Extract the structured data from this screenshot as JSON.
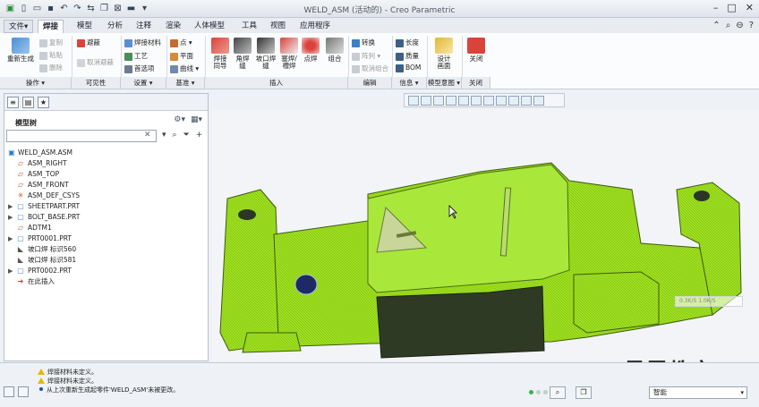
{
  "app": {
    "title": "WELD_ASM (活动的) - Creo Parametric"
  },
  "tabs": [
    "文件",
    "焊接",
    "模型",
    "分析",
    "注释",
    "渲染",
    "人体模型",
    "工具",
    "视图",
    "应用程序"
  ],
  "ribbon": {
    "operations": {
      "regenerate": "重新生成",
      "copy": "复制",
      "paste": "粘贴",
      "delete": "删除",
      "group": "操作"
    },
    "visibility": {
      "avoid": "避蔽",
      "cancel_avoid": "取消避蔽",
      "group": "可见性"
    },
    "settings": {
      "weld_material": "焊接材料",
      "process": "工艺",
      "preferences": "首选项",
      "group": "设置"
    },
    "datum": {
      "point": "点",
      "plane": "平面",
      "curve": "曲线",
      "group": "基准"
    },
    "insert": {
      "weld_to": "焊接\n同导",
      "fillet": "角焊\n缝",
      "groove": "坡口焊\n缝",
      "plug_slot": "塞焊/\n槽焊",
      "spot": "点焊",
      "combine": "组合",
      "group": "插入"
    },
    "edit": {
      "convert": "转换",
      "pattern": "阵列",
      "ungroup": "取消组合",
      "group": "编辑"
    },
    "info": {
      "length": "长度",
      "mass": "质量",
      "bom": "BOM",
      "group": "信息"
    },
    "model_intent": {
      "notebook": "设计\n画面",
      "group": "模型意图"
    },
    "close": {
      "label": "关闭",
      "group": "关闭"
    }
  },
  "left_panel": {
    "title": "模型树",
    "search_placeholder": "",
    "tree": [
      {
        "label": "WELD_ASM.ASM",
        "icon": "assembly-icon",
        "expand": "",
        "root": true
      },
      {
        "label": "ASM_RIGHT",
        "icon": "datum-plane-icon",
        "expand": ""
      },
      {
        "label": "ASM_TOP",
        "icon": "datum-plane-icon",
        "expand": ""
      },
      {
        "label": "ASM_FRONT",
        "icon": "datum-plane-icon",
        "expand": ""
      },
      {
        "label": "ASM_DEF_CSYS",
        "icon": "csys-icon",
        "expand": ""
      },
      {
        "label": "SHEETPART.PRT",
        "icon": "part-icon",
        "expand": "▶"
      },
      {
        "label": "BOLT_BASE.PRT",
        "icon": "part-icon",
        "expand": "▶"
      },
      {
        "label": "ADTM1",
        "icon": "datum-plane-icon",
        "expand": ""
      },
      {
        "label": "PRT0001.PRT",
        "icon": "part-icon",
        "expand": "▶"
      },
      {
        "label": "坡口焊 标识560",
        "icon": "weld-icon",
        "expand": ""
      },
      {
        "label": "坡口焊 标识581",
        "icon": "weld-icon",
        "expand": ""
      },
      {
        "label": "PRT0002.PRT",
        "icon": "part-icon",
        "expand": "▶"
      },
      {
        "label": "在此插入",
        "icon": "insert-here-icon",
        "expand": ""
      }
    ]
  },
  "viewport": {
    "speed_readout": "0.3K/S     1.0K/S"
  },
  "status": {
    "messages": [
      {
        "type": "warning",
        "text": "焊接材料未定义。"
      },
      {
        "type": "warning",
        "text": "焊接材料未定义。"
      },
      {
        "type": "info",
        "text": "从上次重新生成起零件'WELD_ASM'未被更改。"
      }
    ],
    "filter": "智能"
  },
  "watermark": "最需教育",
  "colors": {
    "model_green": "#9fe21e",
    "model_dark": "#2f3a24",
    "accent": "#1a50b0"
  }
}
